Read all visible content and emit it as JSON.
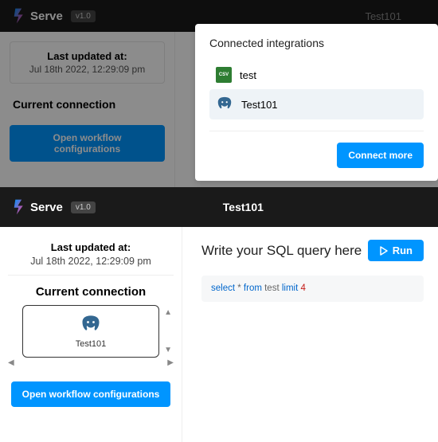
{
  "brand": "Serve",
  "version": "v1.0",
  "top": {
    "title": "Test101",
    "last_updated_label": "Last updated at:",
    "last_updated_value": "Jul 18th 2022, 12:29:09 pm",
    "current_connection_label": "Current connection",
    "open_workflow_btn": "Open workflow configurations"
  },
  "popover": {
    "title": "Connected integrations",
    "items": [
      {
        "icon": "csv",
        "label": "test",
        "selected": false
      },
      {
        "icon": "postgres",
        "label": "Test101",
        "selected": true
      }
    ],
    "connect_more": "Connect more"
  },
  "bottom": {
    "title": "Test101",
    "last_updated_label": "Last updated at:",
    "last_updated_value": "Jul 18th 2022, 12:29:09 pm",
    "current_connection_label": "Current connection",
    "connection_name": "Test101",
    "open_workflow_btn": "Open workflow configurations",
    "query_title": "Write your SQL query here",
    "run_label": "Run",
    "sql": {
      "kw1": "select",
      "star": " * ",
      "kw2": "from",
      "tbl": " test ",
      "kw3": "limit",
      "sp": " ",
      "num": "4"
    }
  }
}
